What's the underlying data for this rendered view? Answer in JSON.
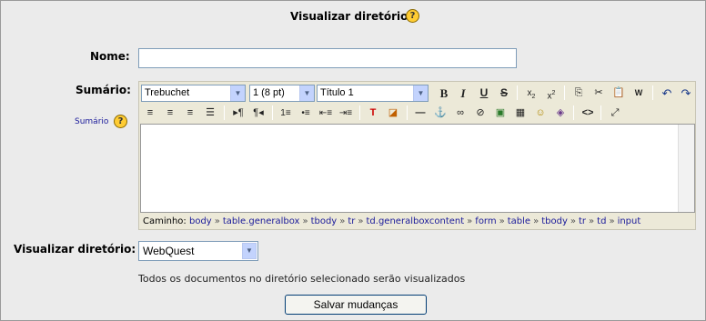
{
  "header": {
    "title": "Visualizar diretório",
    "help_icon": "help-icon"
  },
  "form": {
    "name": {
      "label": "Nome:",
      "value": ""
    },
    "summary": {
      "label": "Sumário:",
      "help_link": "Sumário",
      "editor": {
        "font_family": "Trebuchet",
        "font_size": "1 (8 pt)",
        "paragraph_format": "Título 1",
        "toolbar_row1": [
          "bold-icon",
          "italic-icon",
          "underline-icon",
          "strikethrough-icon",
          "subscript-icon",
          "superscript-icon",
          "copy-icon",
          "cut-icon",
          "paste-icon",
          "paste-word-icon",
          "undo-icon",
          "redo-icon"
        ],
        "toolbar_row2": [
          "align-left-icon",
          "align-center-icon",
          "align-right-icon",
          "justify-icon",
          "ltr-icon",
          "rtl-icon",
          "ordered-list-icon",
          "unordered-list-icon",
          "outdent-icon",
          "indent-icon",
          "text-color-icon",
          "background-color-icon",
          "horizontal-rule-icon",
          "anchor-icon",
          "link-icon",
          "unlink-icon",
          "image-icon",
          "table-icon",
          "smiley-icon",
          "special-char-icon",
          "html-source-icon",
          "fullscreen-icon"
        ],
        "path_label": "Caminho:",
        "path": [
          "body",
          "table.generalbox",
          "tbody",
          "tr",
          "td.generalboxcontent",
          "form",
          "table",
          "tbody",
          "tr",
          "td",
          "input"
        ]
      }
    },
    "view_directory": {
      "label": "Visualizar diretório:",
      "selected": "WebQuest",
      "info": "Todos os documentos no diretório selecionado serão visualizados"
    },
    "save_label": "Salvar mudanças"
  }
}
